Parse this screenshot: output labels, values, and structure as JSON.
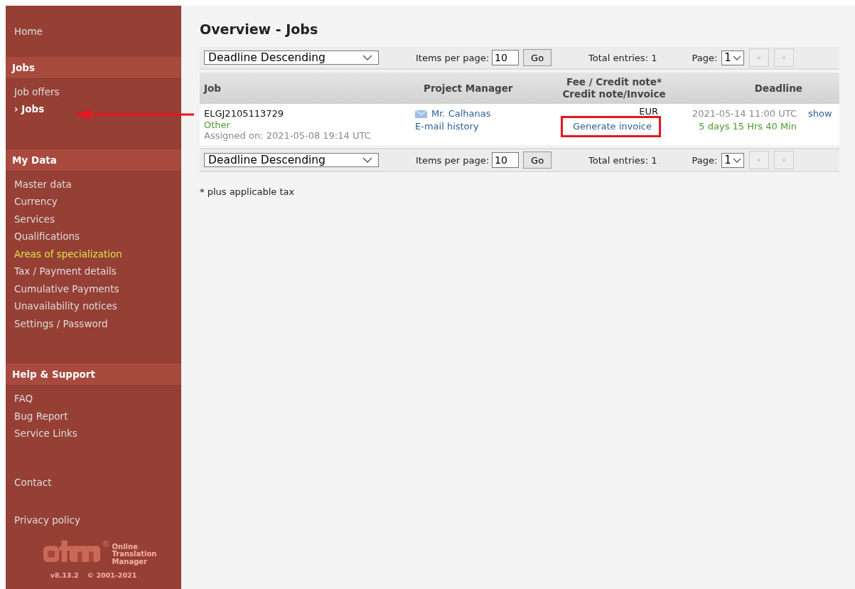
{
  "sidebar": {
    "sections": [
      {
        "items": [
          {
            "label": "Home",
            "kind": "link",
            "selected": false
          }
        ]
      },
      {
        "header": "Jobs",
        "items": [
          {
            "label": "Job offers",
            "kind": "link",
            "selected": false
          },
          {
            "label": "› Jobs",
            "kind": "link",
            "selected": true
          }
        ]
      },
      {
        "header": "My Data",
        "items": [
          {
            "label": "Master data",
            "kind": "link",
            "selected": false
          },
          {
            "label": "Currency",
            "kind": "link",
            "selected": false
          },
          {
            "label": "Services",
            "kind": "link",
            "selected": false
          },
          {
            "label": "Qualifications",
            "kind": "link",
            "selected": false
          },
          {
            "label": "Areas of specialization",
            "kind": "highlight",
            "selected": false
          },
          {
            "label": "Tax / Payment details",
            "kind": "link",
            "selected": false
          },
          {
            "label": "Cumulative Payments",
            "kind": "link",
            "selected": false
          },
          {
            "label": "Unavailability notices",
            "kind": "link",
            "selected": false
          },
          {
            "label": "Settings / Password",
            "kind": "link",
            "selected": false
          }
        ]
      },
      {
        "header": "Help & Support",
        "items": [
          {
            "label": "FAQ",
            "kind": "link",
            "selected": false
          },
          {
            "label": "Bug Report",
            "kind": "link",
            "selected": false
          },
          {
            "label": "Service Links",
            "kind": "link",
            "selected": false
          }
        ]
      },
      {
        "items": [
          {
            "label": "Contact",
            "kind": "link",
            "selected": false
          }
        ]
      },
      {
        "items": [
          {
            "label": "Privacy policy",
            "kind": "link",
            "selected": false
          }
        ]
      }
    ],
    "logo": {
      "mark": "®",
      "lines": [
        "Online",
        "Translation",
        "Manager"
      ],
      "version": "v8.13.2",
      "copyright": "© 2001-2021"
    }
  },
  "page": {
    "title": "Overview - Jobs"
  },
  "toolbars": [
    {
      "sort": "Deadline Descending",
      "items_label": "Items per page:",
      "items_value": "10",
      "go": "Go",
      "total": "Total entries: 1",
      "page_label": "Page:",
      "page_value": "1",
      "prev": "«",
      "next": "»"
    },
    {
      "sort": "Deadline Descending",
      "items_label": "Items per page:",
      "items_value": "10",
      "go": "Go",
      "total": "Total entries: 1",
      "page_label": "Page:",
      "page_value": "1",
      "prev": "«",
      "next": "»"
    }
  ],
  "table": {
    "columns": [
      "Job",
      "Project Manager",
      "Fee / Credit note*\nCredit note/Invoice",
      "Deadline"
    ],
    "rows": [
      {
        "job_id": "ELGJ2105113729",
        "category": "Other",
        "assigned": "Assigned on: 2021-05-08 19:14 UTC",
        "manager": "Mr. Calhanas",
        "email_history": "E-mail history",
        "currency": "EUR",
        "invoice_link": "Generate invoice",
        "invoice_link_highlighted": true,
        "deadline": "2021-05-14 11:00 UTC",
        "remaining": "5 days 15 Hrs 40 Min",
        "action": "show"
      }
    ]
  },
  "footnote": "* plus applicable tax",
  "annotation": {
    "arrow": true
  }
}
